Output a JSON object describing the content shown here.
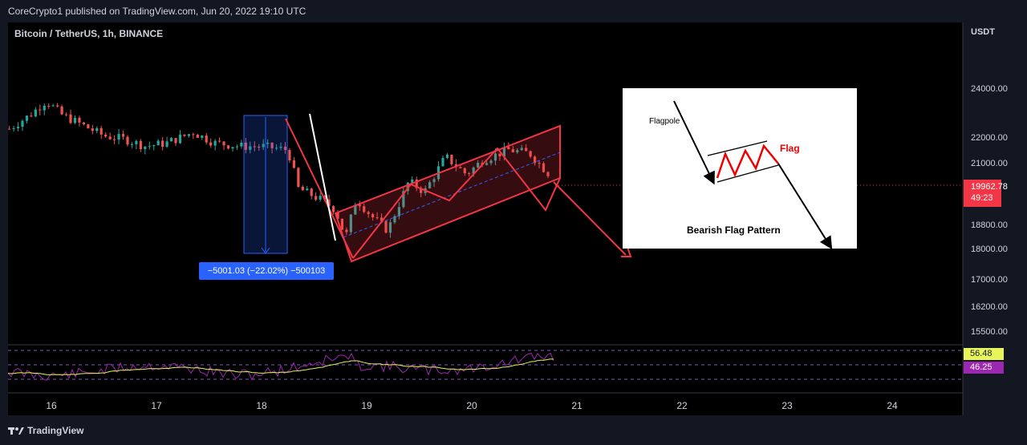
{
  "header": {
    "caption": "CoreCrypto1 published on TradingView.com, Jun 20, 2022 19:10 UTC",
    "symbol": "Bitcoin / TetherUS, 1h, BINANCE"
  },
  "axis": {
    "currency": "USDT",
    "y_ticks": [
      "24000.00",
      "22000.00",
      "21000.00",
      "18800.00",
      "18000.00",
      "17000.00",
      "16200.00",
      "15500.00"
    ],
    "x_ticks": [
      "16",
      "17",
      "18",
      "19",
      "20",
      "21",
      "22",
      "23",
      "24"
    ]
  },
  "price_tag": {
    "price": "19962.78",
    "countdown": "49:23",
    "color": "#f23645"
  },
  "measure": {
    "label": "−5001.03 (−22.02%) −500103"
  },
  "rsi": {
    "value_a": "56.48",
    "value_b": "46.25",
    "color_a": "#e8f55a",
    "color_b": "#9c27b0"
  },
  "inset": {
    "flagpole_label": "Flagpole",
    "flag_label": "Flag",
    "title": "Bearish Flag Pattern"
  },
  "brand": {
    "name": "TradingView"
  },
  "colors": {
    "background": "#131722",
    "bull": "#26a69a",
    "bear": "#ef5350",
    "channel": "#f23645"
  },
  "chart_data": {
    "type": "candlestick",
    "symbol": "Bitcoin / TetherUS, 1h, BINANCE",
    "x_ticks": [
      "16",
      "17",
      "18",
      "19",
      "20",
      "21",
      "22",
      "23",
      "24"
    ],
    "y_axis_unit": "USDT",
    "last_price": 19962.78,
    "close_path": [
      {
        "day": 15.6,
        "price": 21300
      },
      {
        "day": 15.8,
        "price": 21700
      },
      {
        "day": 15.95,
        "price": 22100
      },
      {
        "day": 16.1,
        "price": 21700
      },
      {
        "day": 16.3,
        "price": 21400
      },
      {
        "day": 16.5,
        "price": 21100
      },
      {
        "day": 16.7,
        "price": 21000
      },
      {
        "day": 16.9,
        "price": 20800
      },
      {
        "day": 17.1,
        "price": 20900
      },
      {
        "day": 17.35,
        "price": 21200
      },
      {
        "day": 17.55,
        "price": 20900
      },
      {
        "day": 17.8,
        "price": 20800
      },
      {
        "day": 18.0,
        "price": 20800
      },
      {
        "day": 18.25,
        "price": 20700
      },
      {
        "day": 18.35,
        "price": 19600
      },
      {
        "day": 18.55,
        "price": 19300
      },
      {
        "day": 18.7,
        "price": 19000
      },
      {
        "day": 18.8,
        "price": 18200
      },
      {
        "day": 18.9,
        "price": 19300
      },
      {
        "day": 19.05,
        "price": 18800
      },
      {
        "day": 19.2,
        "price": 18400
      },
      {
        "day": 19.4,
        "price": 19800
      },
      {
        "day": 19.55,
        "price": 19500
      },
      {
        "day": 19.75,
        "price": 20500
      },
      {
        "day": 19.95,
        "price": 20000
      },
      {
        "day": 20.1,
        "price": 20400
      },
      {
        "day": 20.35,
        "price": 20700
      },
      {
        "day": 20.55,
        "price": 20600
      },
      {
        "day": 20.75,
        "price": 19960
      }
    ],
    "annotations": {
      "measured_move": "−5001.03 (−22.02%) −500103",
      "pattern": "Bearish Flag Pattern"
    },
    "rsi": {
      "values": [
        56.48,
        46.25
      ]
    }
  }
}
